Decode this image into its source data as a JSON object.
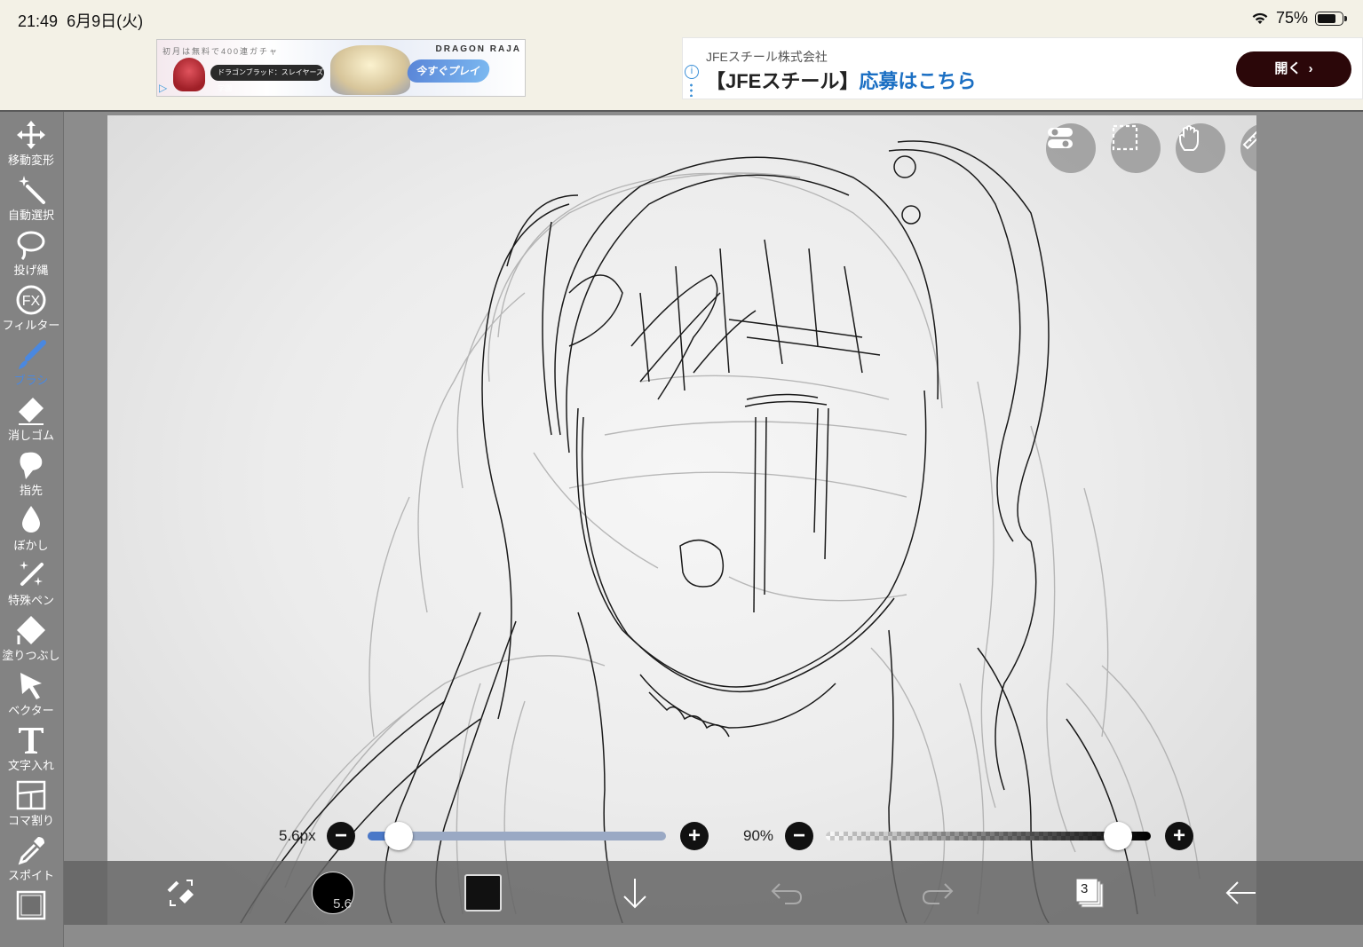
{
  "status_bar": {
    "time": "21:49",
    "date": "6月9日(火)",
    "battery": "75%"
  },
  "ads": {
    "left": {
      "small_text": "初月は無料で400連ガチャ",
      "logo": "DRAGON RAJA",
      "game_text": "ドラゴンブラッド：スレイヤーズ学園",
      "cta": "今すぐプレイ"
    },
    "right": {
      "sponsor": "JFEスチール株式会社",
      "headline_plain": "【JFEスチール】",
      "headline_accent": "応募はこちら",
      "button": "開く"
    }
  },
  "toolbar": {
    "items": [
      {
        "label": "移動変形",
        "icon": "move-arrows-icon"
      },
      {
        "label": "自動選択",
        "icon": "magic-wand-icon"
      },
      {
        "label": "投げ縄",
        "icon": "lasso-icon"
      },
      {
        "label": "フィルター",
        "icon": "fx-icon"
      },
      {
        "label": "ブラシ",
        "icon": "brush-icon",
        "active": true
      },
      {
        "label": "消しゴム",
        "icon": "eraser-icon"
      },
      {
        "label": "指先",
        "icon": "finger-smudge-icon"
      },
      {
        "label": "ぼかし",
        "icon": "blur-drop-icon"
      },
      {
        "label": "特殊ペン",
        "icon": "special-pen-icon"
      },
      {
        "label": "塗りつぶし",
        "icon": "fill-bucket-icon"
      },
      {
        "label": "ベクター",
        "icon": "vector-cursor-icon"
      },
      {
        "label": "文字入れ",
        "icon": "text-t-icon"
      },
      {
        "label": "コマ割り",
        "icon": "panel-divide-icon"
      },
      {
        "label": "スポイト",
        "icon": "eyedropper-icon"
      }
    ],
    "accent_color": "#4a88e0"
  },
  "sliders": {
    "size": {
      "label": "5.6px",
      "value_fraction": 0.05
    },
    "opacity": {
      "label": "90%",
      "value_fraction": 0.9
    }
  },
  "bottom_bar": {
    "brush_size": "5.6",
    "layers_count": "3",
    "color": "#111111"
  }
}
